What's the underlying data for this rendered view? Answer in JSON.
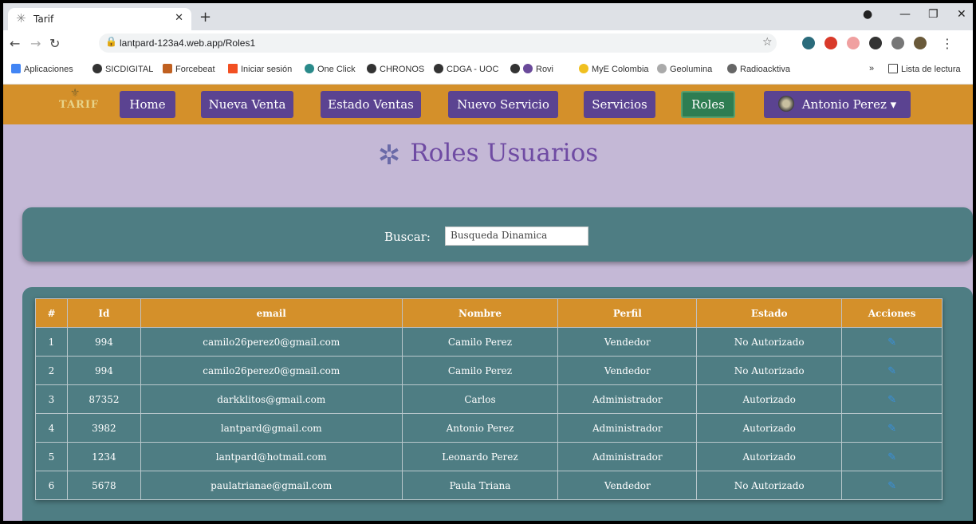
{
  "browser": {
    "tab_title": "Tarif",
    "url": "lantpard-123a4.web.app/Roles1",
    "bookmarks": [
      "Aplicaciones",
      "SICDIGITAL",
      "Forcebeat",
      "Iniciar sesión",
      "One Click",
      "CHRONOS",
      "CDGA - UOC",
      "Rovi",
      "MyE Colombia",
      "Geolumina",
      "Radioacktiva"
    ],
    "reading_list": "Lista de lectura"
  },
  "nav": {
    "logo": "TARIF",
    "items": [
      "Home",
      "Nueva Venta",
      "Estado Ventas",
      "Nuevo Servicio",
      "Servicios",
      "Roles"
    ],
    "user": "Antonio Perez"
  },
  "page": {
    "title": "Roles Usuarios"
  },
  "search": {
    "label": "Buscar:",
    "value": "Busqueda Dinamica"
  },
  "table": {
    "headers": [
      "#",
      "Id",
      "email",
      "Nombre",
      "Perfil",
      "Estado",
      "Acciones"
    ],
    "rows": [
      [
        "1",
        "994",
        "camilo26perez0@gmail.com",
        "Camilo Perez",
        "Vendedor",
        "No Autorizado"
      ],
      [
        "2",
        "994",
        "camilo26perez0@gmail.com",
        "Camilo Perez",
        "Vendedor",
        "No Autorizado"
      ],
      [
        "3",
        "87352",
        "darkklitos@gmail.com",
        "Carlos",
        "Administrador",
        "Autorizado"
      ],
      [
        "4",
        "3982",
        "lantpard@gmail.com",
        "Antonio Perez",
        "Administrador",
        "Autorizado"
      ],
      [
        "5",
        "1234",
        "lantpard@hotmail.com",
        "Leonardo Perez",
        "Administrador",
        "Autorizado"
      ],
      [
        "6",
        "5678",
        "paulatrianae@gmail.com",
        "Paula Triana",
        "Vendedor",
        "No Autorizado"
      ]
    ]
  },
  "colors": {
    "navbar": "#d4902a",
    "nav_button": "#5b4391",
    "active_button": "#2e7d52",
    "panel": "#4e7d83",
    "page_bg": "#c4b8d6",
    "title": "#6f4ba3"
  }
}
